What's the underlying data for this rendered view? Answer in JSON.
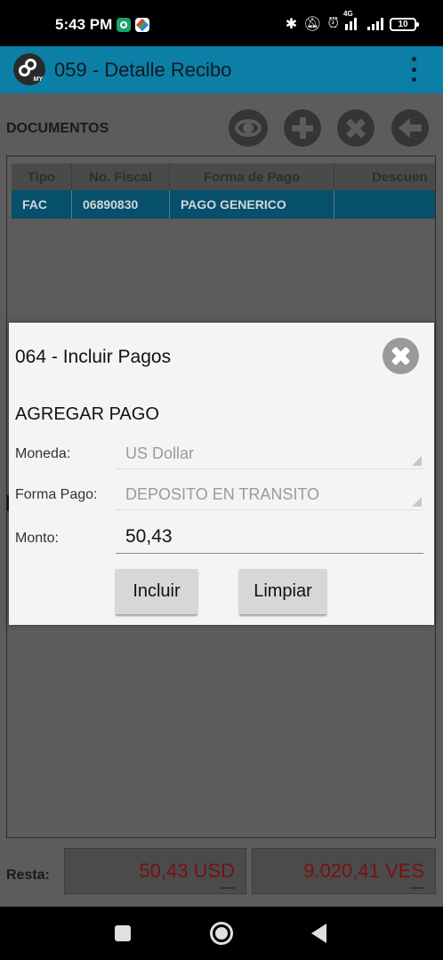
{
  "status_bar": {
    "time": "5:43 PM",
    "network_label": "4G",
    "battery": "10",
    "icons": [
      "shield-app-icon",
      "store-app-icon",
      "bluetooth-icon",
      "notifications-off-icon",
      "alarm-icon",
      "signal-icon",
      "signal-icon",
      "battery-icon"
    ]
  },
  "toolbar": {
    "title": "059 - Detalle Recibo",
    "logo_text": "MY",
    "background": "#0b7fa5"
  },
  "documents": {
    "label": "DOCUMENTOS",
    "actions": [
      "view-icon",
      "add-icon",
      "delete-icon",
      "back-arrow-icon"
    ],
    "columns": [
      "Tipo",
      "No. Fiscal",
      "Forma de Pago",
      "Descuen"
    ],
    "rows": [
      {
        "tipo": "FAC",
        "no_fiscal": "06890830",
        "forma_pago": "PAGO GENERICO",
        "descuento": ""
      }
    ]
  },
  "footer": {
    "resta_label": "Resta:",
    "usd": "50,43 USD",
    "ves": "9.020,41 VES",
    "amount_color": "#7a1010"
  },
  "dialog": {
    "title": "064 - Incluir Pagos",
    "section": "AGREGAR PAGO",
    "moneda_label": "Moneda:",
    "moneda_value": "US Dollar",
    "forma_label": "Forma Pago:",
    "forma_value": "DEPOSITO EN TRANSITO",
    "monto_label": "Monto:",
    "monto_value": "50,43",
    "incluir_label": "Incluir",
    "limpiar_label": "Limpiar"
  },
  "navigation": [
    "recent-apps-icon",
    "home-icon",
    "back-icon"
  ]
}
